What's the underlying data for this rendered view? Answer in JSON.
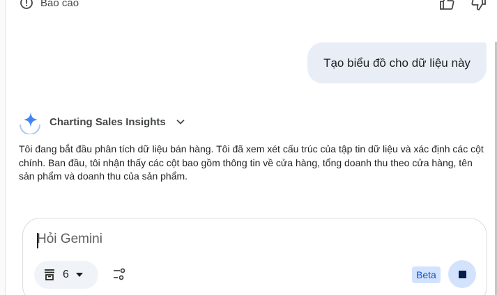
{
  "report": {
    "label": "Báo cáo",
    "icon": "report-icon"
  },
  "feedback": {
    "like_icon": "thumb-up-icon",
    "dislike_icon": "thumb-down-icon"
  },
  "user_message": {
    "text": "Tạo biểu đồ cho dữ liệu này"
  },
  "thought": {
    "title": "Charting Sales Insights",
    "icon": "gemini-spark-icon",
    "toggle_icon": "chevron-down-icon"
  },
  "response": {
    "text": "Tôi đang bắt đầu phân tích dữ liệu bán hàng. Tôi đã xem xét cấu trúc của tập tin dữ liệu và xác định các cột chính. Ban đầu, tôi nhận thấy các cột bao gồm thông tin về cửa hàng, tổng doanh thu theo cửa hàng, tên sản phẩm và doanh thu của sản phẩm."
  },
  "composer": {
    "placeholder": "Hỏi Gemini",
    "source_count": "6",
    "source_icon": "sources-icon",
    "dropdown_icon": "caret-down-icon",
    "tools_icon": "tools-icon",
    "beta_label": "Beta",
    "stop_icon": "stop-icon"
  },
  "colors": {
    "accent": "#0b57d0",
    "bubble": "#e9eef6",
    "stop_bg": "#d3e3fd"
  }
}
